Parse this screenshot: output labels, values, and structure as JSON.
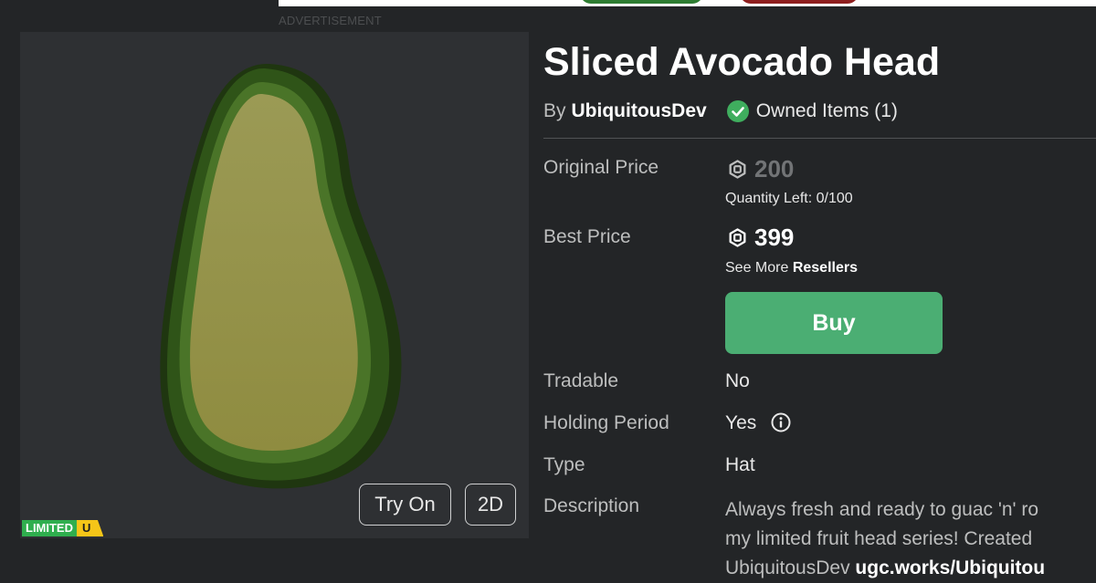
{
  "ad": {
    "label": "ADVERTISEMENT"
  },
  "thumbnail": {
    "try_on_label": "Try On",
    "view_2d_label": "2D",
    "badge_limited": "LIMITED",
    "badge_unique": "U"
  },
  "item": {
    "title": "Sliced Avocado Head",
    "by_prefix": "By",
    "creator": "UbiquitousDev",
    "owned_text": "Owned Items (1)"
  },
  "details": {
    "original_price_label": "Original Price",
    "original_price": "200",
    "quantity_left": "Quantity Left: 0/100",
    "best_price_label": "Best Price",
    "best_price": "399",
    "see_more_prefix": "See More",
    "resellers_link": "Resellers",
    "buy_label": "Buy",
    "tradable_label": "Tradable",
    "tradable_value": "No",
    "holding_label": "Holding Period",
    "holding_value": "Yes",
    "type_label": "Type",
    "type_value": "Hat",
    "description_label": "Description",
    "description_line1": "Always fresh and ready to guac 'n' ro",
    "description_line2": "my limited fruit head series! Created",
    "description_line3_prefix": "UbiquitousDev",
    "description_link": "ugc.works/Ubiquitou"
  },
  "colors": {
    "buy": "#4bae73",
    "check": "#3fae5e",
    "background": "#232527",
    "limited": "#2fae4e",
    "unique": "#f5c518"
  },
  "icons": {
    "robux": "robux-icon",
    "owned": "check-circle-icon",
    "info": "info-icon"
  }
}
